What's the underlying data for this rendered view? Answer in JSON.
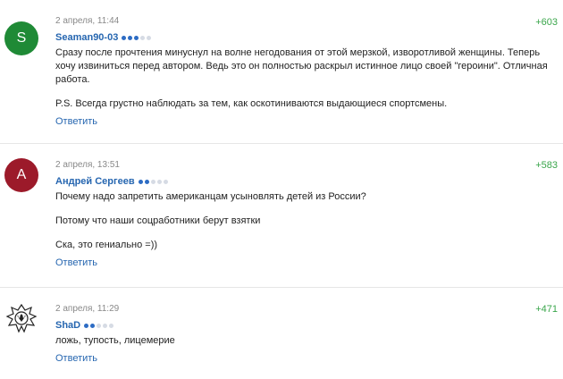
{
  "comments": [
    {
      "date": "2 апреля, 11:44",
      "rating": "+603",
      "avatar_letter": "S",
      "avatar_color": "#1f8a36",
      "author": "Seaman90-03",
      "reputation_dots": 3,
      "paragraphs": [
        "Сразу после прочтения минуснул на волне негодования от этой мерзкой, изворотливой женщины. Теперь хочу извиниться перед автором. Ведь это он полностью раскрыл истинное лицо своей \"героини\". Отличная работа.",
        "P.S. Всегда грустно наблюдать за тем, как оскотиниваются выдающиеся спортсмены."
      ],
      "reply": "Ответить"
    },
    {
      "date": "2 апреля, 13:51",
      "rating": "+583",
      "avatar_letter": "A",
      "avatar_color": "#9c1a2a",
      "author": "Андрей Сергеев",
      "reputation_dots": 2,
      "paragraphs": [
        "Почему надо запретить американцам усыновлять детей из России?",
        "Потому что наши соцработники берут взятки",
        "Ска, это гениально =))"
      ],
      "reply": "Ответить"
    },
    {
      "date": "2 апреля, 11:29",
      "rating": "+471",
      "avatar_icon": "wolf-emblem-icon",
      "author": "ShaD",
      "reputation_dots": 2,
      "paragraphs": [
        "ложь, тупость, лицемерие"
      ],
      "reply": "Ответить"
    }
  ],
  "colors": {
    "link": "#2666b0",
    "rating": "#3aa64b",
    "date": "#888888"
  }
}
